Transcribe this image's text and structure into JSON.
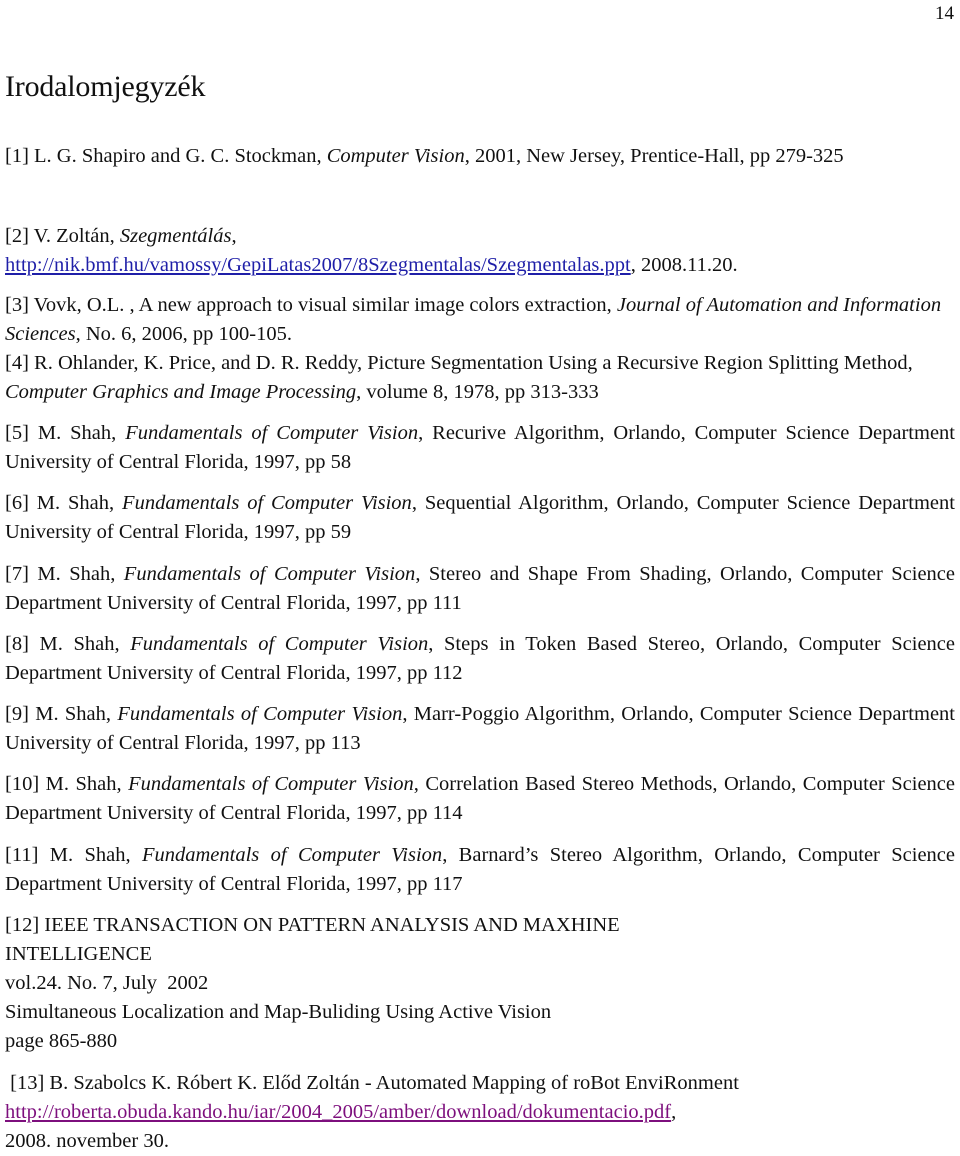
{
  "page": {
    "number": "14",
    "title": "Irodalomjegyzék",
    "link_colors": {
      "unvisited": "#1f1fa8",
      "visited": "#7d0f7d"
    }
  },
  "references": [
    {
      "id": "[1]",
      "authors": "L. G. Shapiro and G. C. Stockman, ",
      "title_italic": "Computer Vision",
      "rest": ", 2001, New Jersey, Prentice-Hall, pp 279-325"
    },
    {
      "id": "[2]",
      "authors": "V. Zoltán, ",
      "title_italic": "Szegmentálás",
      "after_title": ",",
      "url": "http://nik.bmf.hu/vamossy/GepiLatas2007/8Szegmentalas/Szegmentalas.ppt",
      "rest": ", 2008.11.20."
    },
    {
      "id": "[3]",
      "authors": "Vovk, O.L. , A new approach to visual similar image colors extraction, ",
      "title_italic": "Journal of Automation and Information Sciences",
      "rest": ", No. 6, 2006, pp 100-105."
    },
    {
      "id": "[4]",
      "authors": "R. Ohlander, K. Price, and D. R. Reddy, Picture Segmentation Using a Recursive Region Splitting Method, ",
      "title_italic": "Computer Graphics and Image Processing",
      "rest": ", volume 8, 1978, pp 313-333"
    },
    {
      "id": "[5]",
      "authors": "M. Shah, ",
      "title_italic": "Fundamentals of Computer Vision",
      "rest": ", Recurive Algorithm, Orlando, Computer Science Department University of Central Florida, 1997, pp 58"
    },
    {
      "id": "[6]",
      "authors": "M. Shah, ",
      "title_italic": "Fundamentals of Computer Vision",
      "rest": ", Sequential Algorithm, Orlando, Computer Science Department University of Central Florida, 1997, pp 59"
    },
    {
      "id": "[7]",
      "authors": "M. Shah, ",
      "title_italic": "Fundamentals of Computer Vision",
      "rest": ", Stereo and Shape From Shading, Orlando, Computer Science Department University of Central Florida, 1997, pp 111"
    },
    {
      "id": "[8]",
      "authors": "M. Shah, ",
      "title_italic": "Fundamentals of Computer Vision",
      "rest": ", Steps in Token Based Stereo, Orlando, Computer Science Department University of Central Florida, 1997, pp 112"
    },
    {
      "id": "[9]",
      "authors": "M. Shah, ",
      "title_italic": "Fundamentals of Computer Vision",
      "rest": ", Marr-Poggio Algorithm, Orlando, Computer Science Department University of Central Florida, 1997, pp 113"
    },
    {
      "id": "[10]",
      "authors": "M. Shah, ",
      "title_italic": "Fundamentals of Computer Vision",
      "rest": ", Correlation Based Stereo Methods, Orlando, Computer Science Department University of Central Florida, 1997, pp 114"
    },
    {
      "id": "[11]",
      "authors": "M. Shah, ",
      "title_italic": "Fundamentals of Computer Vision",
      "rest": ", Barnard’s Stereo Algorithm, Orlando, Computer Science Department University of Central Florida, 1997, pp 117"
    },
    {
      "id": "[12]",
      "lines": [
        "IEEE TRANSACTION ON PATTERN ANALYSIS AND MAXHINE",
        "INTELLIGENCE",
        "vol.24. No. 7, July  2002",
        "Simultaneous Localization and Map-Buliding Using Active Vision",
        "page 865-880"
      ]
    },
    {
      "id": "[13]",
      "text": "B. Szabolcs K. Róbert K. Előd Zoltán - Automated Mapping of roBot EnviRonment",
      "url": "http://roberta.obuda.kando.hu/iar/2004_2005/amber/download/dokumentacio.pdf",
      "after_url": ",",
      "date": "2008. november 30."
    }
  ]
}
